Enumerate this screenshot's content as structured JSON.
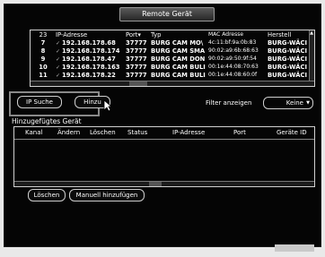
{
  "window": {
    "title": "Remote Gerät"
  },
  "device_table": {
    "columns": [
      "23",
      "IP-Adresse",
      "Port",
      "Typ",
      "MAC Adresse",
      "Herstell"
    ],
    "rows": [
      {
        "no": "7",
        "ip": "192.168.178.68",
        "port": "37777",
        "type": "BURG CAM MO\\",
        "mac": "4c:11:bf:9a:0b:83",
        "man": "BURG-WÄCI"
      },
      {
        "no": "8",
        "ip": "192.168.178.174",
        "port": "37777",
        "type": "BURG CAM SMA",
        "mac": "90:02:a9:6b:68:63",
        "man": "BURG-WÄCI"
      },
      {
        "no": "9",
        "ip": "192.168.178.47",
        "port": "37777",
        "type": "BURG CAM DON",
        "mac": "90:02:a9:50:9f:54",
        "man": "BURG-WÄCI"
      },
      {
        "no": "10",
        "ip": "192.168.178.163",
        "port": "37777",
        "type": "BURG CAM BULI",
        "mac": "00:1e:44:08:70:63",
        "man": "BURG-WÄCI"
      },
      {
        "no": "11",
        "ip": "192.168.178.22",
        "port": "37777",
        "type": "BURG CAM BULI",
        "mac": "00:1e:44:08:60:0f",
        "man": "BURG-WÄCI"
      }
    ]
  },
  "toolbar": {
    "ip_search": "IP Suche",
    "add": "Hinzu",
    "filter_label": "Filter anzeigen",
    "filter_value": "Keine"
  },
  "added_section": {
    "title": "Hinzugefügtes Gerät",
    "columns": [
      "Kanal",
      "Ändern",
      "Löschen",
      "Status",
      "IP-Adresse",
      "Port",
      "Geräte ID"
    ],
    "delete_button": "Löschen",
    "manual_add_button": "Manuell hinzufügen"
  },
  "icons": {
    "cursor": "mouse-pointer-icon",
    "sort": "sort-arrow-icon"
  }
}
